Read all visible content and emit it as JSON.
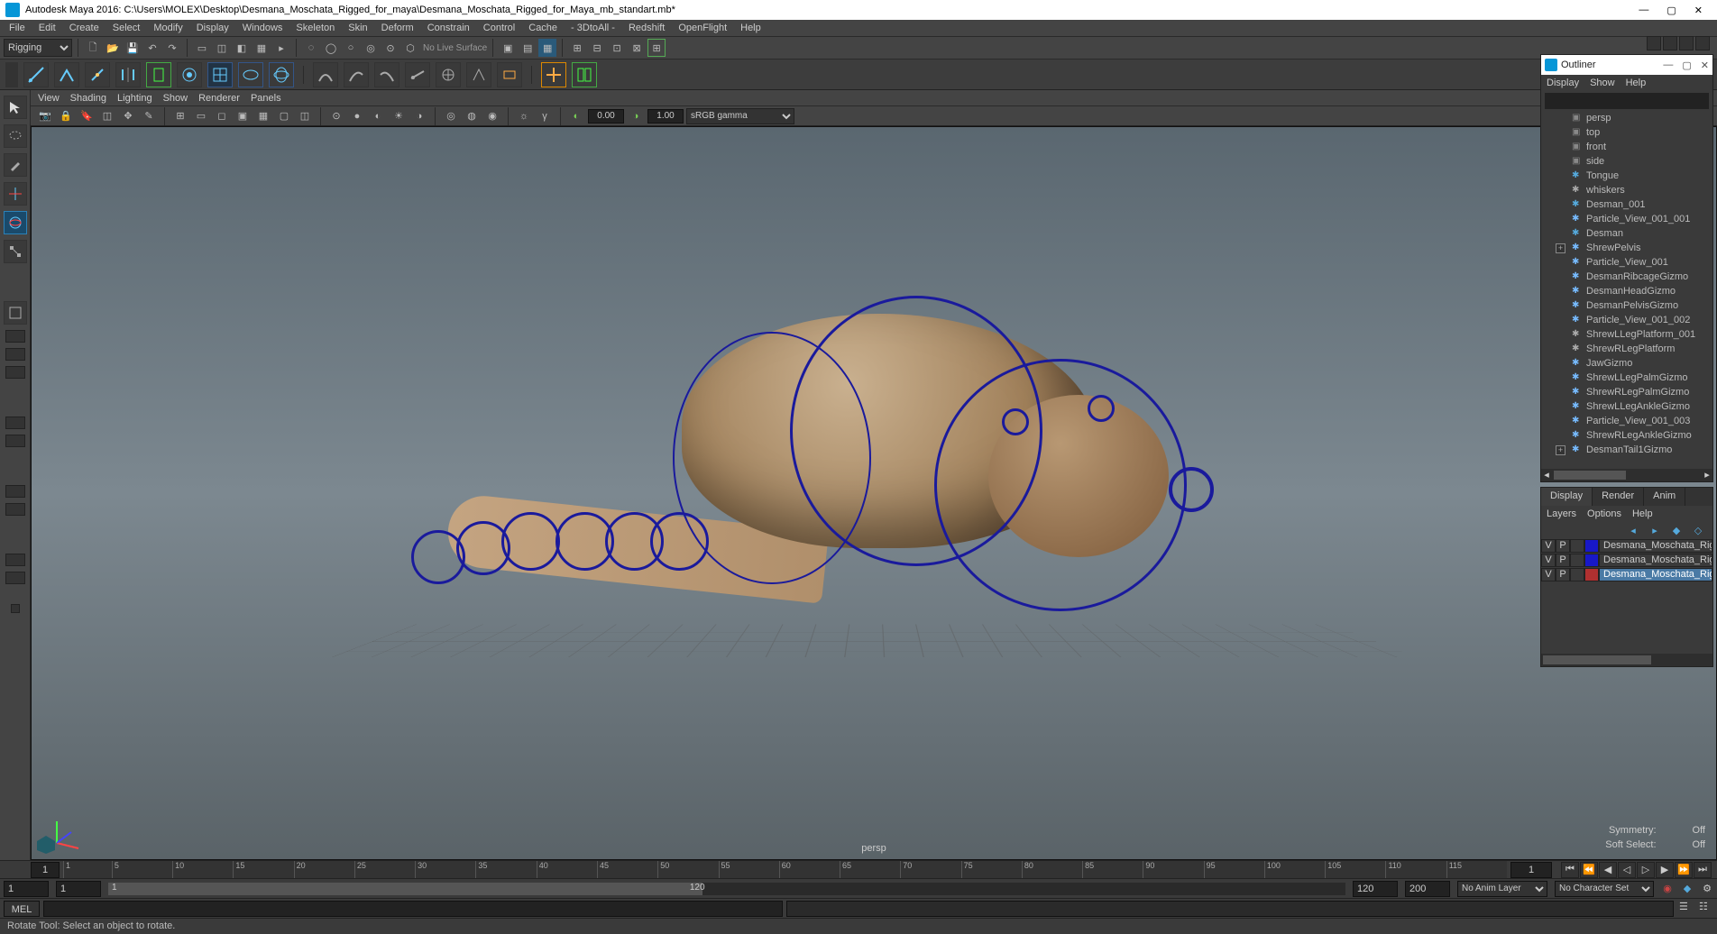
{
  "title": "Autodesk Maya 2016: C:\\Users\\MOLEX\\Desktop\\Desmana_Moschata_Rigged_for_maya\\Desmana_Moschata_Rigged_for_Maya_mb_standart.mb*",
  "menu": [
    "File",
    "Edit",
    "Create",
    "Select",
    "Modify",
    "Display",
    "Windows",
    "Skeleton",
    "Skin",
    "Deform",
    "Constrain",
    "Control",
    "Cache",
    "- 3DtoAll -",
    "Redshift",
    "OpenFlight",
    "Help"
  ],
  "workspace_dropdown": "Rigging",
  "live_surface": "No Live Surface",
  "viewport_menu": [
    "View",
    "Shading",
    "Lighting",
    "Show",
    "Renderer",
    "Panels"
  ],
  "vp_num1": "0.00",
  "vp_num2": "1.00",
  "vp_color_space": "sRGB gamma",
  "camera_label": "persp",
  "status_right": {
    "sym_l": "Symmetry:",
    "sym_v": "Off",
    "ss_l": "Soft Select:",
    "ss_v": "Off"
  },
  "outliner": {
    "title": "Outliner",
    "menu": [
      "Display",
      "Show",
      "Help"
    ],
    "items": [
      {
        "icon": "cam",
        "label": "persp"
      },
      {
        "icon": "cam",
        "label": "top"
      },
      {
        "icon": "cam",
        "label": "front"
      },
      {
        "icon": "cam",
        "label": "side"
      },
      {
        "icon": "mesh",
        "label": "Tongue"
      },
      {
        "icon": "curve",
        "label": "whiskers"
      },
      {
        "icon": "mesh",
        "label": "Desman_001"
      },
      {
        "icon": "part",
        "label": "Particle_View_001_001"
      },
      {
        "icon": "mesh",
        "label": "Desman"
      },
      {
        "icon": "joint",
        "label": "ShrewPelvis",
        "exp": true
      },
      {
        "icon": "part",
        "label": "Particle_View_001"
      },
      {
        "icon": "giz",
        "label": "DesmanRibcageGizmo"
      },
      {
        "icon": "giz",
        "label": "DesmanHeadGizmo"
      },
      {
        "icon": "giz",
        "label": "DesmanPelvisGizmo"
      },
      {
        "icon": "part",
        "label": "Particle_View_001_002"
      },
      {
        "icon": "plat",
        "label": "ShrewLLegPlatform_001"
      },
      {
        "icon": "plat",
        "label": "ShrewRLegPlatform"
      },
      {
        "icon": "giz",
        "label": "JawGizmo"
      },
      {
        "icon": "giz",
        "label": "ShrewLLegPalmGizmo"
      },
      {
        "icon": "giz",
        "label": "ShrewRLegPalmGizmo"
      },
      {
        "icon": "giz",
        "label": "ShrewLLegAnkleGizmo"
      },
      {
        "icon": "part",
        "label": "Particle_View_001_003"
      },
      {
        "icon": "giz",
        "label": "ShrewRLegAnkleGizmo"
      },
      {
        "icon": "giz",
        "label": "DesmanTail1Gizmo",
        "exp": true
      }
    ]
  },
  "chbox": {
    "tabs": [
      "Display",
      "Render",
      "Anim"
    ],
    "menu": [
      "Layers",
      "Options",
      "Help"
    ],
    "layers": [
      {
        "v": "V",
        "p": "P",
        "color": "#1818c8",
        "name": "Desmana_Moschata_Rigged_",
        "sel": false
      },
      {
        "v": "V",
        "p": "P",
        "color": "#1818c8",
        "name": "Desmana_Moschata_Rigged_",
        "sel": false
      },
      {
        "v": "V",
        "p": "P",
        "color": "#b03030",
        "name": "Desmana_Moschata_Rigged",
        "sel": true
      }
    ]
  },
  "timeline": {
    "start_frame": "1",
    "ticks": [
      1,
      5,
      10,
      15,
      20,
      25,
      30,
      35,
      40,
      45,
      50,
      55,
      60,
      65,
      70,
      75,
      80,
      85,
      90,
      95,
      100,
      105,
      110,
      115,
      120
    ],
    "end_box": "1"
  },
  "range": {
    "start": "1",
    "in": "1",
    "cursor": "1",
    "out": "120",
    "end": "120",
    "total": "200",
    "anim_layer": "No Anim Layer",
    "char_set": "No Character Set"
  },
  "cmd_lang": "MEL",
  "help_line": "Rotate Tool: Select an object to rotate."
}
